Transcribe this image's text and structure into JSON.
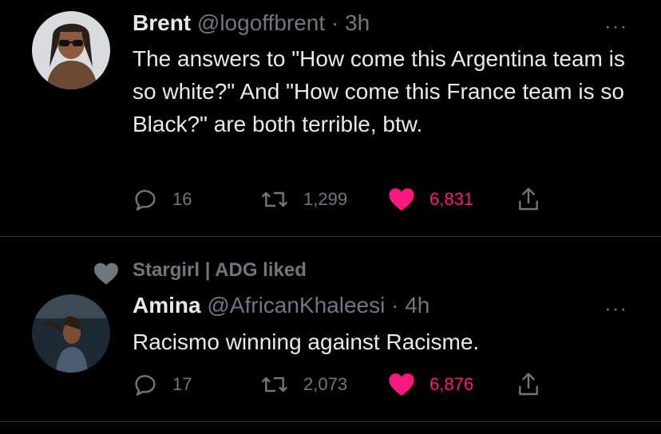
{
  "tweets": [
    {
      "name": "Brent",
      "handle": "@logoffbrent",
      "time": "· 3h",
      "more": "···",
      "text": "The answers to \"How come this Argentina team is so white?\" And \"How come this France team is so Black?\" are both terrible, btw.",
      "replies": "16",
      "retweets": "1,299",
      "likes": "6,831",
      "avatar_icon": "avatar-man-sunglasses"
    },
    {
      "social_context": "Stargirl | ADG liked",
      "name": "Amina",
      "handle": "@AfricanKhaleesi",
      "time": "· 4h",
      "more": "···",
      "text": "Racismo winning against Racisme.",
      "replies": "17",
      "retweets": "2,073",
      "likes": "6,876",
      "avatar_icon": "avatar-woman-dancing"
    }
  ],
  "colors": {
    "background": "#000000",
    "text": "#e7e9ea",
    "muted": "#71767b",
    "like": "#f91880",
    "divider": "#2f3336"
  }
}
